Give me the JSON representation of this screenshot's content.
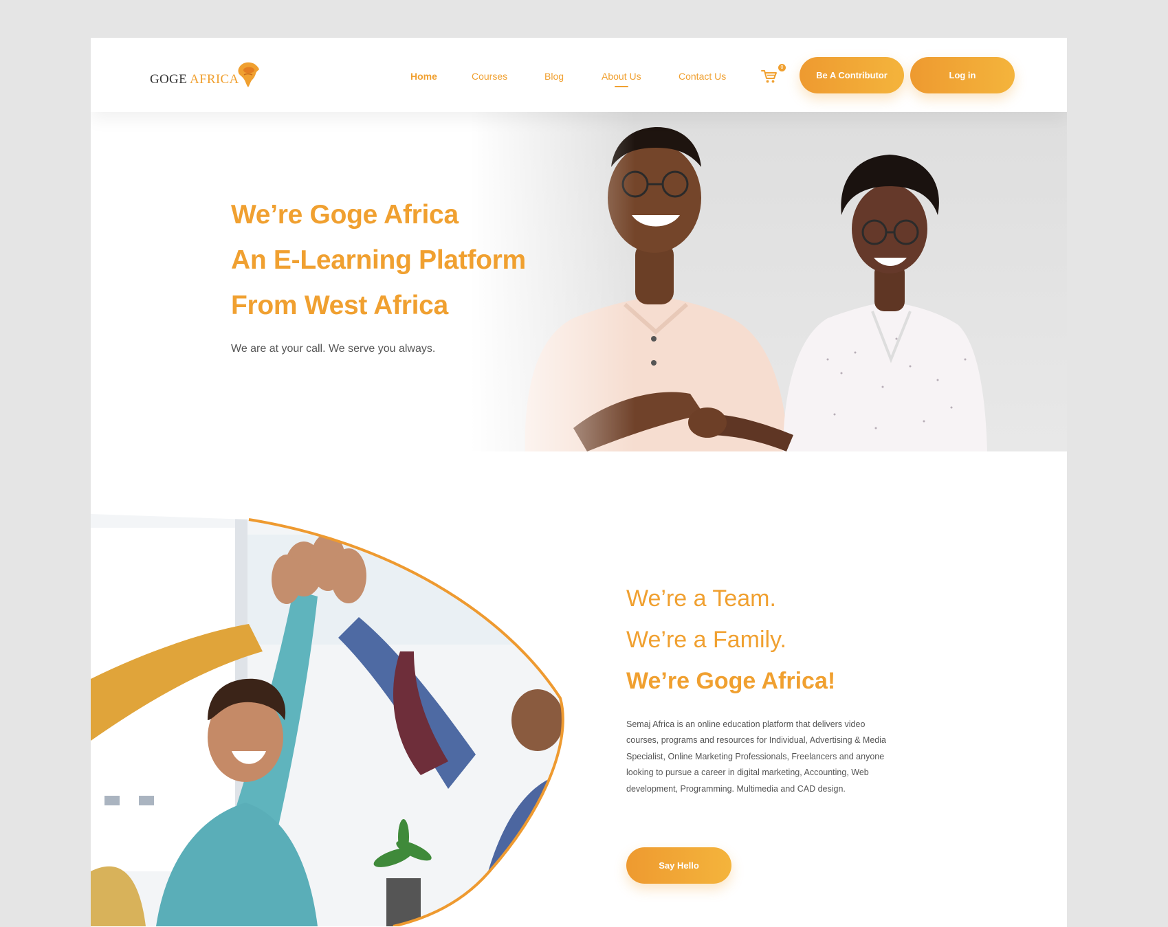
{
  "logo": {
    "word1": "GOGE ",
    "word2": "AFRICA"
  },
  "nav": {
    "items": [
      {
        "label": "Home"
      },
      {
        "label": "Courses"
      },
      {
        "label": "Blog"
      },
      {
        "label": "About Us"
      },
      {
        "label": "Contact Us"
      }
    ],
    "cart_count": "0",
    "contributor_label": "Be A Contributor",
    "login_label": "Log in"
  },
  "hero": {
    "title_lines": [
      "We’re Goge Africa",
      "An E-Learning Platform",
      "From West Africa"
    ],
    "subtitle": "We are at your call. We serve you always."
  },
  "team": {
    "lines": [
      "We’re a Team.",
      "We’re a Family.",
      "We’re Goge Africa!"
    ],
    "body": "Semaj Africa is an online education platform that delivers video courses, programs and resources for Individual, Advertising & Media Specialist, Online Marketing Professionals, Freelancers and anyone looking to pursue a career in digital marketing, Accounting, Web development, Programming. Multimedia and CAD design.",
    "cta_label": "Say Hello"
  },
  "colors": {
    "accent": "#f0a030",
    "accent_light": "#f4b43c",
    "text": "#555555",
    "background": "#e5e5e5"
  },
  "icons": [
    "logo-africa-mark-icon",
    "cart-icon"
  ]
}
